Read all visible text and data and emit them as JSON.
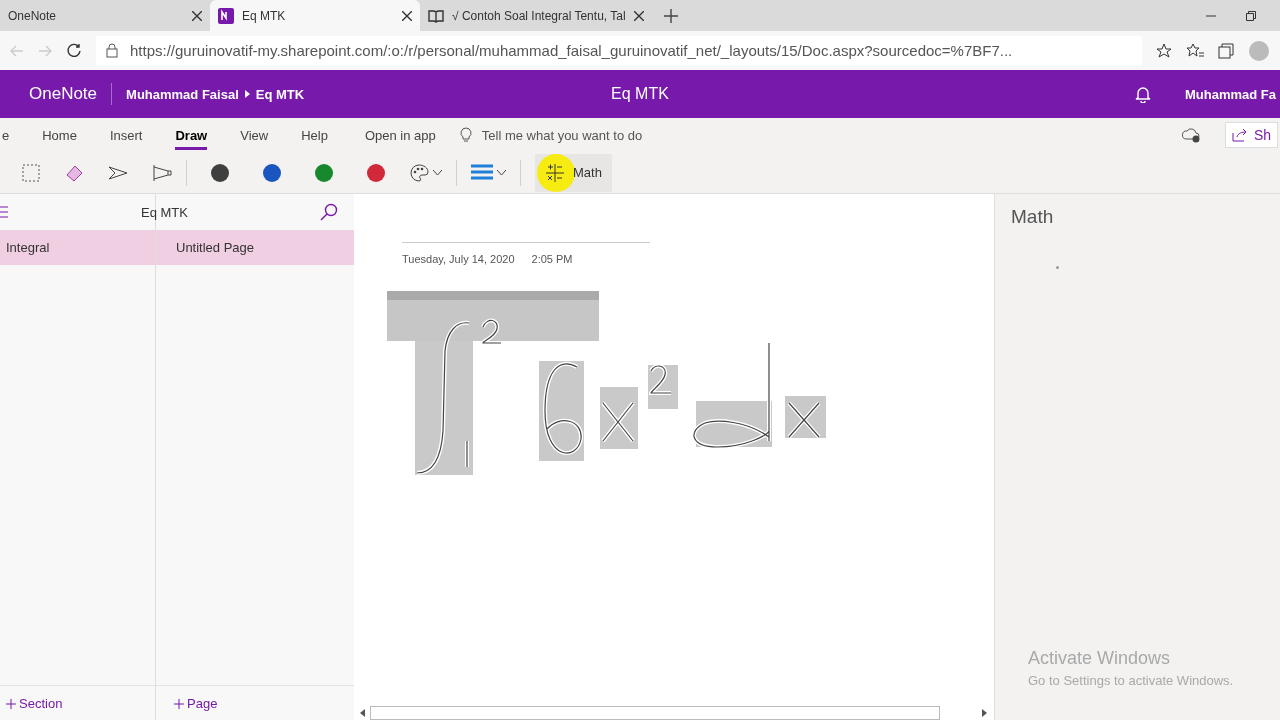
{
  "browser_tabs": [
    {
      "title": "OneNote",
      "selected": false,
      "kind": "plain"
    },
    {
      "title": "Eq MTK",
      "selected": true,
      "kind": "onenote"
    },
    {
      "title": "√ Contoh Soal Integral Tentu, Tal",
      "selected": false,
      "kind": "book"
    }
  ],
  "address_bar": {
    "url": "https://guruinovatif-my.sharepoint.com/:o:/r/personal/muhammad_faisal_guruinovatif_net/_layouts/15/Doc.aspx?sourcedoc=%7BF7..."
  },
  "app_header": {
    "app_name": "OneNote",
    "breadcrumb": [
      "Muhammad Faisal",
      "Eq MTK"
    ],
    "title": "Eq MTK",
    "user": "Muhammad Fa"
  },
  "ribbon_tabs": [
    {
      "label": "e",
      "selected": false
    },
    {
      "label": "Home",
      "selected": false
    },
    {
      "label": "Insert",
      "selected": false
    },
    {
      "label": "Draw",
      "selected": true
    },
    {
      "label": "View",
      "selected": false
    },
    {
      "label": "Help",
      "selected": false
    }
  ],
  "open_in_app": "Open in app",
  "tell_me": "Tell me what you want to do",
  "share": "Sh",
  "pens": [
    {
      "color": "#3f3f3f"
    },
    {
      "color": "#1a55c0"
    },
    {
      "color": "#17882c"
    },
    {
      "color": "#d1283a"
    }
  ],
  "math_button": "Math",
  "notebook": {
    "title": "Eq MTK",
    "sections": [
      {
        "name": "Integral",
        "selected": true
      }
    ],
    "pages": [
      {
        "name": "Untitled Page",
        "selected": true
      }
    ],
    "add_section": "Section",
    "add_page": "Page"
  },
  "page": {
    "date": "Tuesday, July 14, 2020",
    "time": "2:05 PM"
  },
  "math_pane": {
    "title": "Math"
  },
  "os_notice": {
    "title": "Activate Windows",
    "text": "Go to Settings to activate Windows."
  }
}
